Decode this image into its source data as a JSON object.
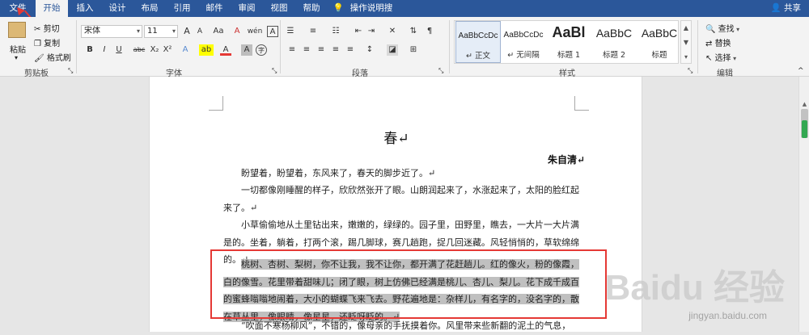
{
  "tabs": [
    "文件",
    "开始",
    "插入",
    "设计",
    "布局",
    "引用",
    "邮件",
    "审阅",
    "视图",
    "帮助",
    "操作说明搜索"
  ],
  "share_label": "共享",
  "clipboard": {
    "paste": "粘贴",
    "cut": "剪切",
    "copy": "复制",
    "format_painter": "格式刷",
    "group": "剪贴板"
  },
  "font": {
    "name": "宋体",
    "size": "11",
    "group": "字体",
    "bold": "B",
    "italic": "I",
    "underline": "U",
    "strike": "abc",
    "subscript": "X₂",
    "superscript": "X²",
    "grow": "A",
    "shrink": "A",
    "case": "Aa",
    "clear": "A",
    "pinyin": "wén",
    "border": "A",
    "effects": "A",
    "highlight": "ab",
    "color": "A",
    "shading": "A",
    "encircle": "字"
  },
  "paragraph": {
    "group": "段落"
  },
  "styles": {
    "group": "样式",
    "items": [
      {
        "preview": "AaBbCcDc",
        "name": "↵ 正文"
      },
      {
        "preview": "AaBbCcDc",
        "name": "↵ 无间隔"
      },
      {
        "preview": "AaBl",
        "name": "标题 1"
      },
      {
        "preview": "AaBbC",
        "name": "标题 2"
      },
      {
        "preview": "AaBbC",
        "name": "标题"
      }
    ]
  },
  "editing": {
    "group": "编辑",
    "find": "查找",
    "replace": "替换",
    "select": "选择"
  },
  "document": {
    "title": "春↵",
    "author": "朱自清↵",
    "paragraphs": [
      "盼望着，盼望着，东风来了，春天的脚步近了。↵",
      "一切都像刚睡醒的样子，欣欣然张开了眼。山朗润起来了，水涨起来了，太阳的脸红起来了。↵",
      "小草偷偷地从土里钻出来，嫩嫩的，绿绿的。园子里，田野里，瞧去，一大片一大片满是的。坐着，躺着，打两个滚，踢几脚球，赛几趟跑，捉几回迷藏。风轻悄悄的，草软绵绵的。↵",
      "桃树、杏树、梨树，你不让我，我不让你，都开满了花赶趟儿。红的像火，粉的像霞，白的像雪。花里带着甜味儿；闭了眼，树上仿佛已经满是桃儿、杏儿、梨儿。花下成千成百的蜜蜂嗡嗡地闹着，大小的蝴蝶飞来飞去。野花遍地是：杂样儿，有名字的，没名字的，散在草丛里，像眼睛，像星星，还眨呀眨的。↵",
      "“吹面不寒杨柳风”，不错的，像母亲的手抚摸着你。风里带来些新翻的泥土的气息，"
    ]
  },
  "watermark": {
    "brand": "Baidu 经验",
    "url": "jingyan.baidu.com"
  },
  "colors": {
    "accent": "#2b579a",
    "highlight": "#c0c0c0",
    "annotation": "#e53935"
  }
}
